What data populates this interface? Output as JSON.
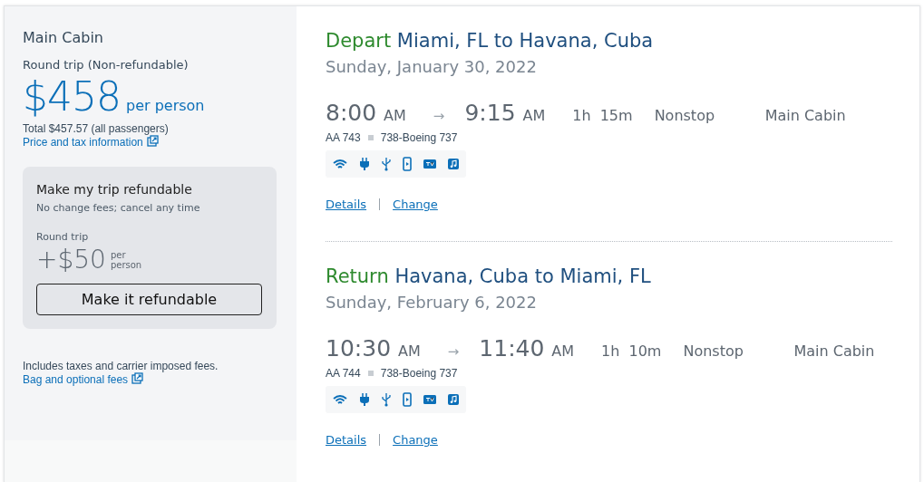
{
  "fare": {
    "cabin": "Main Cabin",
    "trip_type": "Round trip (Non-refundable)",
    "currency": "$",
    "price": "458",
    "price_unit": "per person",
    "total": "Total $457.57 (all passengers)",
    "price_link": "Price and tax information"
  },
  "refund_offer": {
    "title": "Make my trip refundable",
    "subtitle": "No change fees; cancel any time",
    "trip_type": "Round trip",
    "price": "+$50",
    "unit_line_1": "per",
    "unit_line_2": "person",
    "button": "Make it refundable"
  },
  "fees_note": "Includes taxes and carrier imposed fees.",
  "fees_link": "Bag and optional fees",
  "flights": [
    {
      "direction": "Depart",
      "route": "Miami, FL to Havana, Cuba",
      "date": "Sunday, January 30, 2022",
      "depart_time": "8:00",
      "depart_period": "AM",
      "arrow": "→",
      "arrive_time": "9:15",
      "arrive_period": "AM",
      "duration": "1h 15m",
      "stops": "Nonstop",
      "cabin": "Main Cabin",
      "flight_number": "AA 743",
      "aircraft": "738-Boeing 737",
      "links": [
        "Details",
        "Change"
      ]
    },
    {
      "direction": "Return",
      "route": "Havana, Cuba to Miami, FL",
      "date": "Sunday, February 6, 2022",
      "depart_time": "10:30",
      "depart_period": "AM",
      "arrow": "→",
      "arrive_time": "11:40",
      "arrive_period": "AM",
      "duration": "1h 10m",
      "stops": "Nonstop",
      "cabin": "Main Cabin",
      "flight_number": "AA 744",
      "aircraft": "738-Boeing 737",
      "links": [
        "Details",
        "Change"
      ]
    }
  ]
}
